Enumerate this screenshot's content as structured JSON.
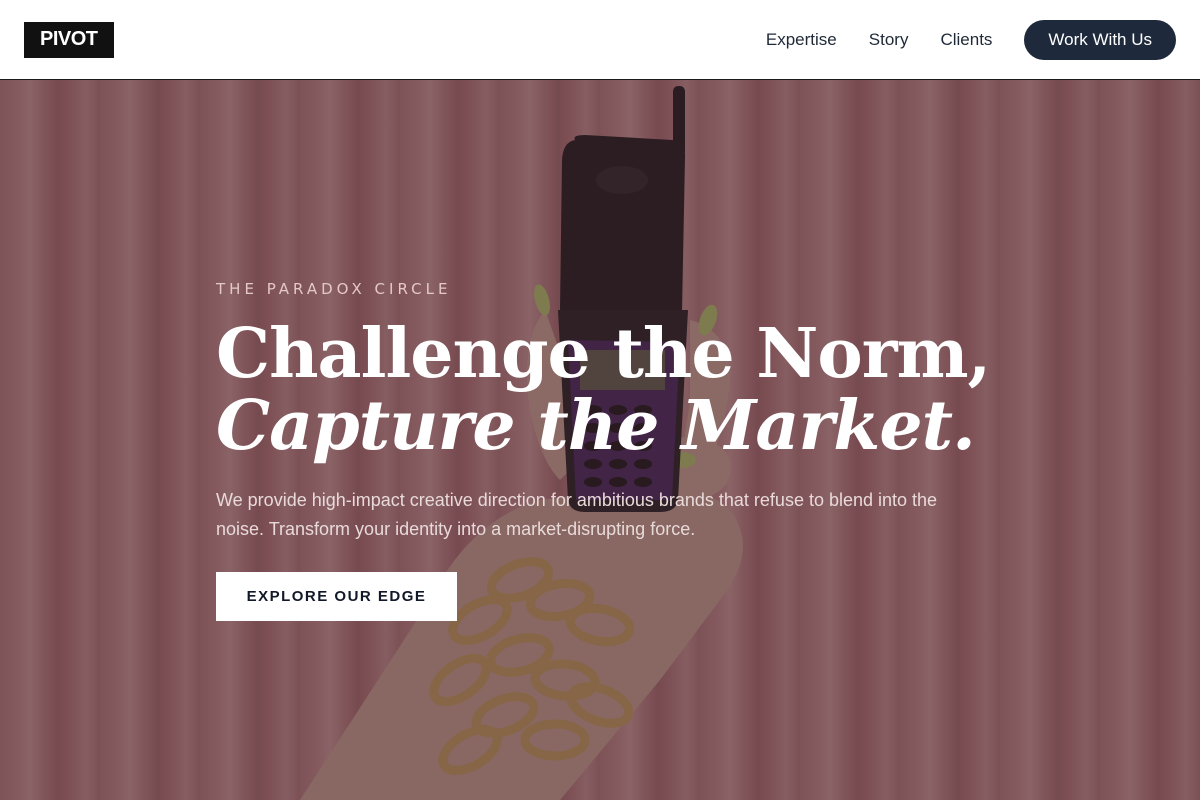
{
  "header": {
    "logo": "PIVOT",
    "nav": [
      {
        "label": "Expertise"
      },
      {
        "label": "Story"
      },
      {
        "label": "Clients"
      }
    ],
    "cta_label": "Work With Us"
  },
  "hero": {
    "eyebrow": "THE PARADOX CIRCLE",
    "headline_line1": "Challenge the Norm,",
    "headline_line2": "Capture the Market.",
    "subtext": "We provide high-impact creative direction for ambitious brands that refuse to blend into the noise. Transform your identity into a market-disrupting force.",
    "button_label": "EXPLORE OUR EDGE",
    "image": "hand-holding-flip-phone-with-gold-chain-bracelets"
  },
  "colors": {
    "logo_bg": "#111111",
    "cta_bg": "#1e293b",
    "hero_curtain": "#c98c8e",
    "overlay": "#3a1e26"
  }
}
